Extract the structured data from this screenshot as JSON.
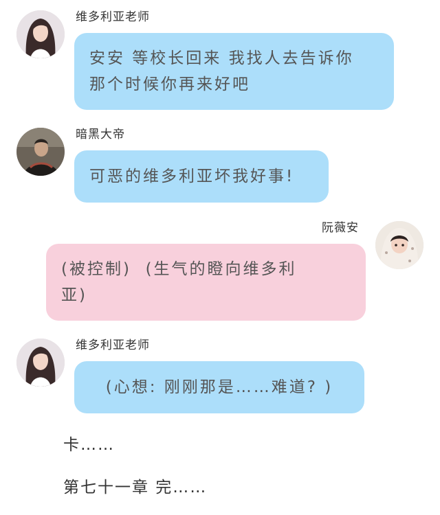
{
  "messages": [
    {
      "speaker": "维多利亚老师",
      "side": "left",
      "avatar_icon": "teacher-avatar",
      "text": "安安 等校长回来 我找人去告诉你\n那个时候你再来好吧",
      "bubble_color": "#acdefa"
    },
    {
      "speaker": "暗黑大帝",
      "side": "left",
      "avatar_icon": "dark-emperor-avatar",
      "text": "可恶的维多利亚坏我好事!",
      "bubble_color": "#acdefa"
    },
    {
      "speaker": "阮薇安",
      "side": "right",
      "avatar_icon": "child-avatar",
      "text": "(被控制)  (生气的瞪向维多利\n亚)",
      "bubble_color": "#f8d0dc"
    },
    {
      "speaker": "维多利亚老师",
      "side": "left",
      "avatar_icon": "teacher-avatar",
      "text": "(心想: 刚刚那是……难道? )",
      "bubble_color": "#acdefa"
    }
  ],
  "footer": {
    "line1": "卡……",
    "line2": "第七十一章 完……"
  }
}
